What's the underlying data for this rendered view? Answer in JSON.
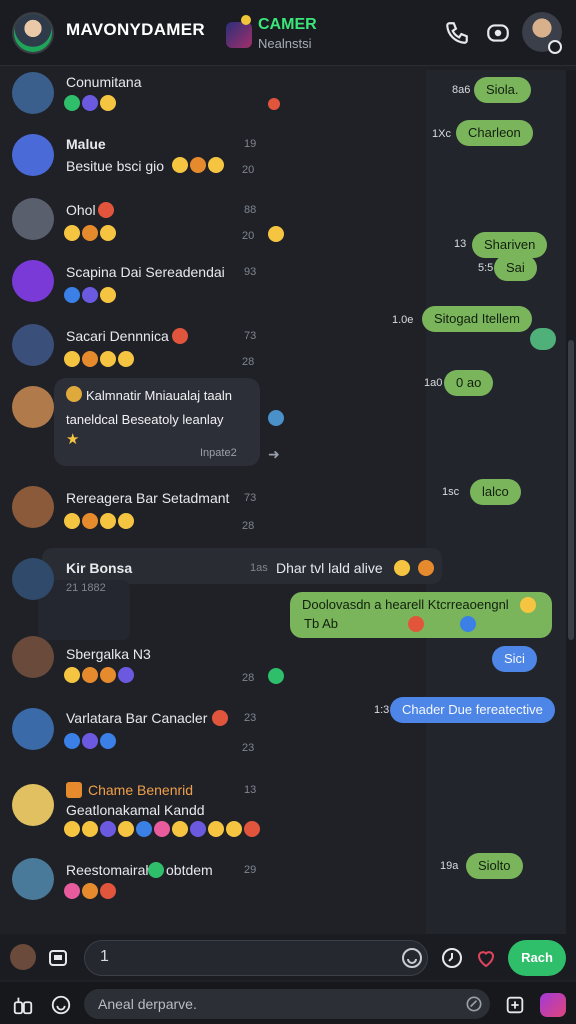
{
  "header": {
    "title": "MAVONYDAMER",
    "group_name": "CAMER",
    "group_status": "Nealnstsi"
  },
  "chats": [
    {
      "name": "Conumitana",
      "time": "",
      "meta": ""
    },
    {
      "name": "Malue",
      "preview": "Besitue bsci gio",
      "time": "19",
      "meta": "20"
    },
    {
      "name": "Ohol",
      "time": "88",
      "meta": "20"
    },
    {
      "name": "Scapina Dai Sereadendai",
      "time": "93",
      "meta": ""
    },
    {
      "name": "Sacari Dennnica",
      "time": "73",
      "meta": "28"
    },
    {
      "name": "Rereagera Bar Setadmant",
      "time": "73",
      "meta": "28"
    },
    {
      "name": "Kir Bonsa",
      "time": "1as",
      "preview": "Dhar tvl lald alive",
      "meta": "21 1882"
    },
    {
      "name": "Sbergalka N3",
      "time": "",
      "meta": "28"
    },
    {
      "name": "Varlatara Bar Canacler",
      "time": "23",
      "meta": "23"
    },
    {
      "name": "Chame Benenrid",
      "preview": "Geatlonakamal Kandd",
      "time": "13",
      "meta": ""
    },
    {
      "name": "Reestomairah",
      "preview": "obtdem",
      "time": "29",
      "meta": ""
    }
  ],
  "popover": {
    "line1": "Kalmnatir Mniaualaj taaln",
    "line2": "taneldcal Beseatoly leanlay",
    "meta": "Inpate2"
  },
  "bubbles": [
    {
      "text": "Siola.",
      "time": "8a6"
    },
    {
      "text": "Charleon",
      "time": "1Xc"
    },
    {
      "text": "Shariven",
      "time": "13"
    },
    {
      "text": "Sai",
      "time": "5:5"
    },
    {
      "text": "Sitogad Itellem",
      "time": "1.0e"
    },
    {
      "text": "0 ao",
      "time": "1a0"
    },
    {
      "text": "lalco",
      "time": "1sc"
    },
    {
      "text": "Sici",
      "time": ""
    },
    {
      "text": "Chader Due fereatective",
      "time": "1:3"
    },
    {
      "text": "Siolto",
      "time": "19a"
    }
  ],
  "big_bubble": {
    "line1": "Doolovasdn  a hearell Ktcrreaoengnl",
    "line2": "Tb   Ab"
  },
  "composer": {
    "value": "1",
    "send_label": "Rach"
  },
  "bottom": {
    "placeholder": "Aneal derparve."
  },
  "colors": {
    "accent_green": "#2fbe6a",
    "bubble_green": "#7ab55c",
    "bubble_blue": "#4d86e6",
    "background": "#1e2026"
  }
}
